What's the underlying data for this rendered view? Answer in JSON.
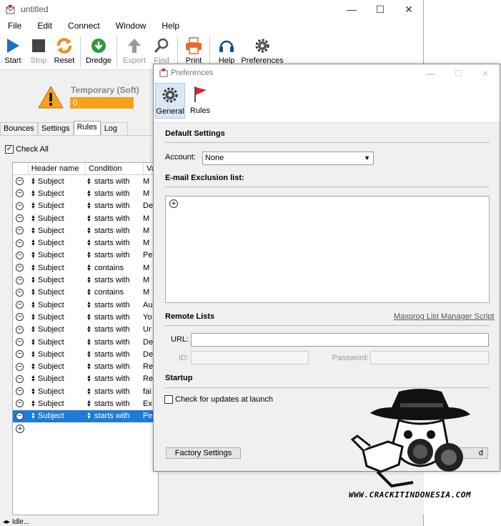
{
  "window": {
    "title": "untitled",
    "controls": {
      "minimize": "—",
      "maximize": "☐",
      "close": "✕"
    }
  },
  "menubar": [
    "File",
    "Edit",
    "Connect",
    "Window",
    "Help"
  ],
  "toolbar": {
    "start": "Start",
    "stop": "Stop",
    "reset": "Reset",
    "dredge": "Dredge",
    "export": "Export",
    "find": "Find",
    "print": "Print",
    "help": "Help",
    "preferences": "Preferences"
  },
  "status": {
    "temporary_label": "Temporary (Soft)",
    "temporary_count": "0"
  },
  "tabs": [
    "Bounces",
    "Settings",
    "Rules",
    "Log"
  ],
  "rules": {
    "check_all": "Check All",
    "columns": [
      "Header name",
      "Condition",
      "Va"
    ],
    "rows": [
      {
        "header": "Subject",
        "condition": "starts with",
        "value": "M"
      },
      {
        "header": "Subject",
        "condition": "starts with",
        "value": "M"
      },
      {
        "header": "Subject",
        "condition": "starts with",
        "value": "De"
      },
      {
        "header": "Subject",
        "condition": "starts with",
        "value": "M"
      },
      {
        "header": "Subject",
        "condition": "starts with",
        "value": "M"
      },
      {
        "header": "Subject",
        "condition": "starts with",
        "value": "M"
      },
      {
        "header": "Subject",
        "condition": "starts with",
        "value": "Pe"
      },
      {
        "header": "Subject",
        "condition": "contains",
        "value": "M"
      },
      {
        "header": "Subject",
        "condition": "starts with",
        "value": "M"
      },
      {
        "header": "Subject",
        "condition": "contains",
        "value": "M"
      },
      {
        "header": "Subject",
        "condition": "starts with",
        "value": "Au"
      },
      {
        "header": "Subject",
        "condition": "starts with",
        "value": "Yo"
      },
      {
        "header": "Subject",
        "condition": "starts with",
        "value": "Ur"
      },
      {
        "header": "Subject",
        "condition": "starts with",
        "value": "De"
      },
      {
        "header": "Subject",
        "condition": "starts with",
        "value": "De"
      },
      {
        "header": "Subject",
        "condition": "starts with",
        "value": "Re"
      },
      {
        "header": "Subject",
        "condition": "starts with",
        "value": "Re"
      },
      {
        "header": "Subject",
        "condition": "starts with",
        "value": "fai"
      },
      {
        "header": "Subject",
        "condition": "starts with",
        "value": "Ex"
      },
      {
        "header": "Subject",
        "condition": "starts with",
        "value": "Pe"
      }
    ],
    "selected_index": 19
  },
  "statusbar": {
    "text": "Idle..."
  },
  "preferences": {
    "title": "Preferences",
    "tabs": {
      "general": "General",
      "rules": "Rules"
    },
    "default_settings": "Default Settings",
    "account_label": "Account:",
    "account_value": "None",
    "exclusion_label": "E-mail Exclusion list:",
    "remote_lists": "Remote Lists",
    "script_link": "Maxprog List Manager Script",
    "url_label": "URL:",
    "url_value": "",
    "id_label": "ID:",
    "password_label": "Password:",
    "startup": "Startup",
    "check_updates": "Check for updates at launch",
    "factory_settings": "Factory Settings",
    "second_button_tail": "d"
  },
  "watermark": {
    "text": "WWW.CRACKITINDONESIA.COM"
  },
  "colors": {
    "accent_blue": "#1e7bd8",
    "warning_orange": "#f7a21b",
    "dredge_green": "#2a9a3a",
    "start_blue": "#1a6fc9",
    "reset_orange": "#f08c1a",
    "print_orange": "#e8672a",
    "rules_flag_red": "#d9252f"
  }
}
